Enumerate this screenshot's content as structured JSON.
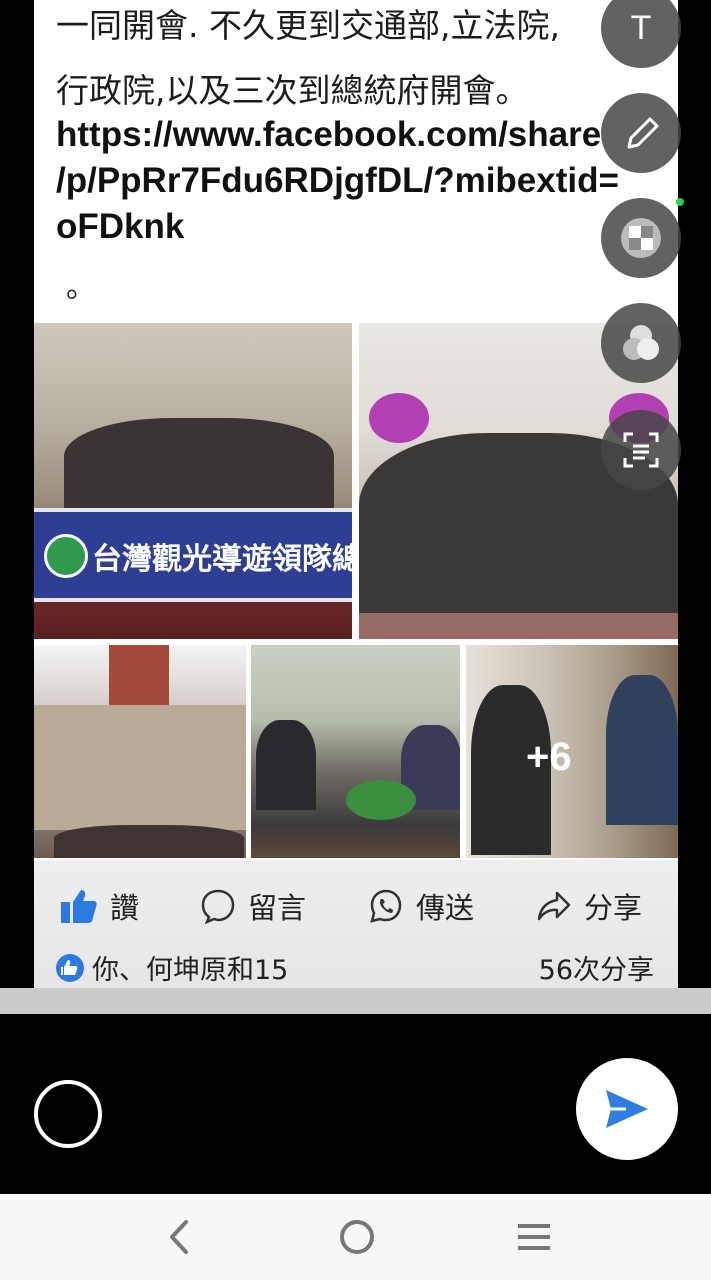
{
  "post": {
    "text_line1": "一同開會. 不久更到交通部,立法院,",
    "text_line2": "行政院,以及三次到總統府開會。",
    "link_lines": [
      "https://www.facebook.com/share",
      "/p/PpRr7Fdu6RDjgfDL/?mibextid=",
      "oFDknk"
    ],
    "trailing_dot": "。",
    "banner_text": "台灣觀光導遊領隊總會",
    "more_photos": "+6"
  },
  "actions": {
    "like": "讚",
    "comment": "留言",
    "send": "傳送",
    "share": "分享"
  },
  "reactions": {
    "names": "你、何坤原和15",
    "shares": "56次分享"
  },
  "tools": {
    "text_tool": "T"
  },
  "colors": {
    "like_blue": "#2a7ae2",
    "send_blue": "#2f7de1"
  }
}
